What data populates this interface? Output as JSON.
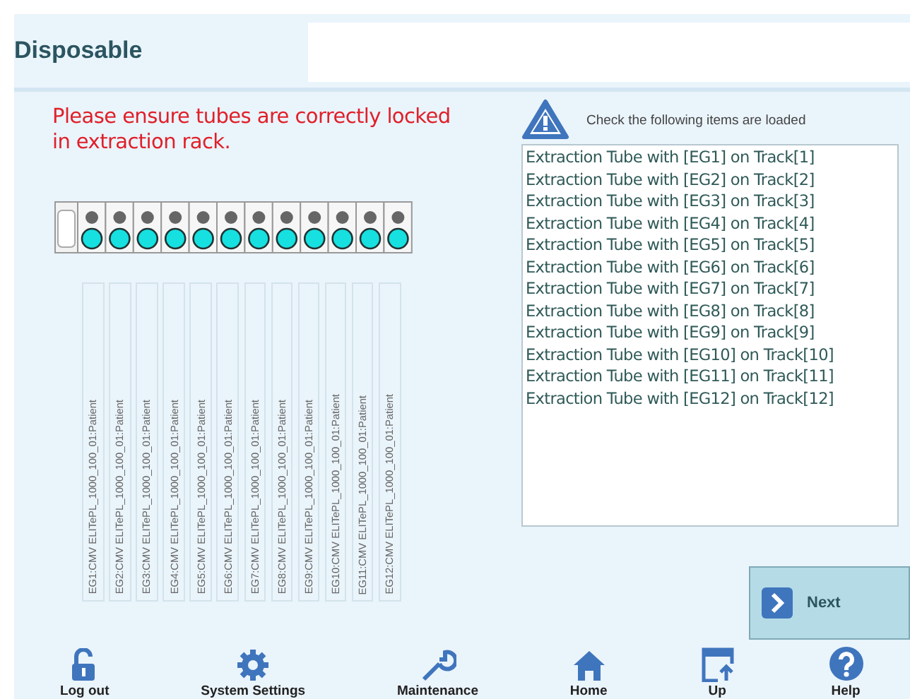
{
  "header": {
    "title": "Disposable"
  },
  "instruction": "Please ensure tubes are correctly locked in extraction rack.",
  "rack": {
    "slots": [
      {
        "loaded": true
      },
      {
        "loaded": true
      },
      {
        "loaded": true
      },
      {
        "loaded": true
      },
      {
        "loaded": true
      },
      {
        "loaded": true
      },
      {
        "loaded": true
      },
      {
        "loaded": true
      },
      {
        "loaded": true
      },
      {
        "loaded": true
      },
      {
        "loaded": true
      },
      {
        "loaded": true
      }
    ]
  },
  "tube_labels": [
    "EG1:CMV ELITePL_1000_100_01:Patient",
    "EG2:CMV ELITePL_1000_100_01:Patient",
    "EG3:CMV ELITePL_1000_100_01:Patient",
    "EG4:CMV ELITePL_1000_100_01:Patient",
    "EG5:CMV ELITePL_1000_100_01:Patient",
    "EG6:CMV ELITePL_1000_100_01:Patient",
    "EG7:CMV ELITePL_1000_100_01:Patient",
    "EG8:CMV ELITePL_1000_100_01:Patient",
    "EG9:CMV ELITePL_1000_100_01:Patient",
    "EG10:CMV ELITePL_1000_100_01:Patient",
    "EG11:CMV ELITePL_1000_100_01:Patient",
    "EG12:CMV ELITePL_1000_100_01:Patient"
  ],
  "checklist": {
    "heading": "Check the following items are loaded",
    "items": [
      "Extraction Tube with [EG1] on Track[1]",
      "Extraction Tube with [EG2] on Track[2]",
      "Extraction Tube with [EG3] on Track[3]",
      "Extraction Tube with [EG4] on Track[4]",
      "Extraction Tube with [EG5] on Track[5]",
      "Extraction Tube with [EG6] on Track[6]",
      "Extraction Tube with [EG7] on Track[7]",
      "Extraction Tube with [EG8] on Track[8]",
      "Extraction Tube with [EG9] on Track[9]",
      "Extraction Tube with [EG10] on Track[10]",
      "Extraction Tube with [EG11] on Track[11]",
      "Extraction Tube with [EG12] on Track[12]"
    ]
  },
  "next_button": "Next",
  "nav": [
    {
      "kind": "logout",
      "label": "Log out"
    },
    {
      "kind": "settings",
      "label": "System Settings"
    },
    {
      "kind": "maintenance",
      "label": "Maintenance"
    },
    {
      "kind": "home",
      "label": "Home"
    },
    {
      "kind": "up",
      "label": "Up"
    },
    {
      "kind": "help",
      "label": "Help"
    }
  ]
}
